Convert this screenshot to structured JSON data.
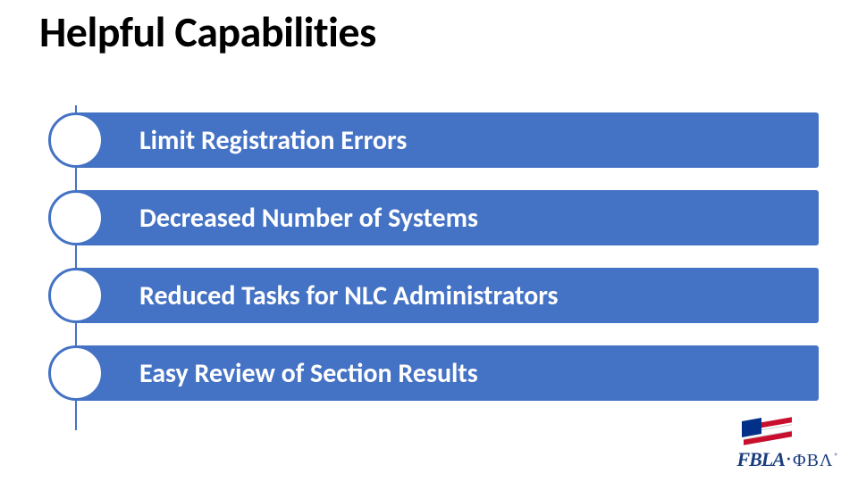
{
  "title": "Helpful Capabilities",
  "items": [
    {
      "label": "Limit Registration Errors"
    },
    {
      "label": "Decreased Number of Systems"
    },
    {
      "label": "Reduced Tasks for NLC Administrators"
    },
    {
      "label": "Easy Review of Section Results"
    }
  ],
  "logo": {
    "text1": "FBLA",
    "text2": "ΦΒΛ"
  },
  "colors": {
    "accent": "#4472c4",
    "logo_navy": "#1a3d7c",
    "flag_red": "#c8102e",
    "flag_blue": "#003087"
  }
}
